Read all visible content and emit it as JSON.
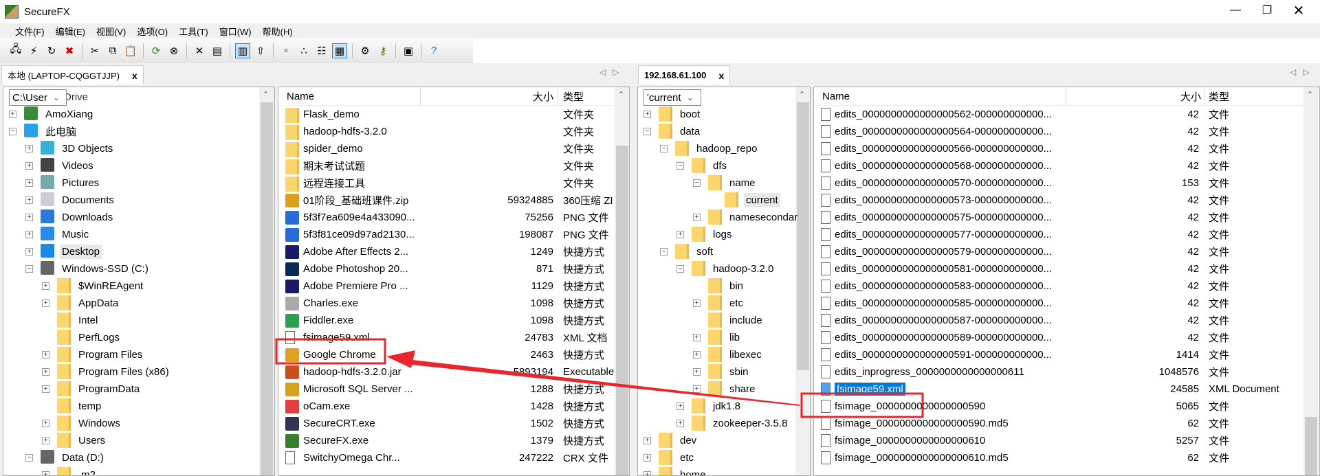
{
  "window": {
    "title": "SecureFX",
    "controls": [
      "minimize",
      "restore",
      "close"
    ]
  },
  "menu": [
    "文件(F)",
    "编辑(E)",
    "视图(V)",
    "选项(O)",
    "工具(T)",
    "窗口(W)",
    "帮助(H)"
  ],
  "toolbar": [
    "connect-icon",
    "quick-connect-icon",
    "reconnect-icon",
    "disconnect-icon",
    "|",
    "cut-icon",
    "copy-icon",
    "paste-icon",
    "|",
    "refresh-icon",
    "stop-icon",
    "|",
    "delete-icon",
    "properties-icon",
    "|",
    "tree-view-icon",
    "up-folder-icon",
    "|",
    "large-icons-icon",
    "small-icons-icon",
    "list-view-icon",
    "details-view-icon",
    "|",
    "session-options-icon",
    "key-icon",
    "|",
    "transfer-queue-icon",
    "|",
    "help-icon"
  ],
  "colors": {
    "accent": "#0078d7",
    "annotation": "#e8262b",
    "folder": "#fbd66e"
  },
  "local": {
    "tab": "本地 (LAPTOP-CQGGTJJP)",
    "path_combo": "C:\\User",
    "tree_partial_top": "Drive",
    "tree": [
      {
        "label": "AmoXiang",
        "level": 0,
        "exp": "+",
        "icon": "user-icon"
      },
      {
        "label": "此电脑",
        "level": 0,
        "exp": "-",
        "icon": "computer-icon"
      },
      {
        "label": "3D Objects",
        "level": 1,
        "exp": "+",
        "icon": "3d-objects-icon"
      },
      {
        "label": "Videos",
        "level": 1,
        "exp": "+",
        "icon": "videos-icon"
      },
      {
        "label": "Pictures",
        "level": 1,
        "exp": "+",
        "icon": "pictures-icon"
      },
      {
        "label": "Documents",
        "level": 1,
        "exp": "+",
        "icon": "documents-icon"
      },
      {
        "label": "Downloads",
        "level": 1,
        "exp": "+",
        "icon": "downloads-icon"
      },
      {
        "label": "Music",
        "level": 1,
        "exp": "+",
        "icon": "music-icon"
      },
      {
        "label": "Desktop",
        "level": 1,
        "exp": "+",
        "icon": "desktop-icon",
        "selected": true
      },
      {
        "label": "Windows-SSD (C:)",
        "level": 1,
        "exp": "-",
        "icon": "drive-icon"
      },
      {
        "label": "$WinREAgent",
        "level": 2,
        "exp": "+",
        "icon": "folder-icon"
      },
      {
        "label": "AppData",
        "level": 2,
        "exp": "+",
        "icon": "folder-icon"
      },
      {
        "label": "Intel",
        "level": 2,
        "exp": "",
        "icon": "folder-icon"
      },
      {
        "label": "PerfLogs",
        "level": 2,
        "exp": "",
        "icon": "folder-icon"
      },
      {
        "label": "Program Files",
        "level": 2,
        "exp": "+",
        "icon": "folder-icon"
      },
      {
        "label": "Program Files (x86)",
        "level": 2,
        "exp": "+",
        "icon": "folder-icon"
      },
      {
        "label": "ProgramData",
        "level": 2,
        "exp": "+",
        "icon": "folder-icon"
      },
      {
        "label": "temp",
        "level": 2,
        "exp": "",
        "icon": "folder-icon"
      },
      {
        "label": "Windows",
        "level": 2,
        "exp": "+",
        "icon": "folder-icon"
      },
      {
        "label": "Users",
        "level": 2,
        "exp": "+",
        "icon": "folder-icon"
      },
      {
        "label": "Data (D:)",
        "level": 1,
        "exp": "-",
        "icon": "drive-icon"
      },
      {
        "label": ".m2",
        "level": 2,
        "exp": "+",
        "icon": "folder-icon"
      }
    ],
    "columns": {
      "name": "Name",
      "size": "大小",
      "type": "类型"
    },
    "files": [
      {
        "name": "Flask_demo",
        "size": "",
        "type": "文件夹",
        "icon": "folder-icon"
      },
      {
        "name": "hadoop-hdfs-3.2.0",
        "size": "",
        "type": "文件夹",
        "icon": "folder-icon"
      },
      {
        "name": "spider_demo",
        "size": "",
        "type": "文件夹",
        "icon": "folder-icon"
      },
      {
        "name": "期末考试试题",
        "size": "",
        "type": "文件夹",
        "icon": "folder-icon"
      },
      {
        "name": "远程连接工具",
        "size": "",
        "type": "文件夹",
        "icon": "folder-icon"
      },
      {
        "name": "01阶段_基础班课件.zip",
        "size": "59324885",
        "type": "360压缩 ZI",
        "icon": "zip-icon"
      },
      {
        "name": "5f3f7ea609e4a433090...",
        "size": "75256",
        "type": "PNG 文件",
        "icon": "image-icon"
      },
      {
        "name": "5f3f81ce09d97ad2130...",
        "size": "198087",
        "type": "PNG 文件",
        "icon": "image-icon"
      },
      {
        "name": "Adobe After Effects 2...",
        "size": "1249",
        "type": "快捷方式",
        "icon": "after-effects-icon"
      },
      {
        "name": "Adobe Photoshop 20...",
        "size": "871",
        "type": "快捷方式",
        "icon": "photoshop-icon"
      },
      {
        "name": "Adobe Premiere Pro ...",
        "size": "1129",
        "type": "快捷方式",
        "icon": "premiere-icon"
      },
      {
        "name": "Charles.exe",
        "size": "1098",
        "type": "快捷方式",
        "icon": "charles-icon"
      },
      {
        "name": "Fiddler.exe",
        "size": "1098",
        "type": "快捷方式",
        "icon": "fiddler-icon"
      },
      {
        "name": "fsimage59.xml",
        "size": "24783",
        "type": "XML 文档",
        "icon": "file-icon"
      },
      {
        "name": "Google Chrome",
        "size": "2463",
        "type": "快捷方式",
        "icon": "chrome-icon"
      },
      {
        "name": "hadoop-hdfs-3.2.0.jar",
        "size": "5893194",
        "type": "Executable",
        "icon": "jar-icon"
      },
      {
        "name": "Microsoft SQL Server ...",
        "size": "1288",
        "type": "快捷方式",
        "icon": "sql-server-icon"
      },
      {
        "name": "oCam.exe",
        "size": "1428",
        "type": "快捷方式",
        "icon": "ocam-icon"
      },
      {
        "name": "SecureCRT.exe",
        "size": "1502",
        "type": "快捷方式",
        "icon": "securecrt-icon"
      },
      {
        "name": "SecureFX.exe",
        "size": "1379",
        "type": "快捷方式",
        "icon": "securefx-icon"
      },
      {
        "name": "SwitchyOmega Chr...",
        "size": "247222",
        "type": "CRX 文件",
        "icon": "file-icon"
      }
    ]
  },
  "remote": {
    "tab": "192.168.61.100",
    "path_combo": "'current",
    "tree": [
      {
        "label": "boot",
        "level": 0,
        "exp": "+"
      },
      {
        "label": "data",
        "level": 0,
        "exp": "-"
      },
      {
        "label": "hadoop_repo",
        "level": 1,
        "exp": "-"
      },
      {
        "label": "dfs",
        "level": 2,
        "exp": "-"
      },
      {
        "label": "name",
        "level": 3,
        "exp": "-"
      },
      {
        "label": "current",
        "level": 4,
        "exp": "",
        "selected": true
      },
      {
        "label": "namesecondar",
        "level": 3,
        "exp": "+"
      },
      {
        "label": "logs",
        "level": 2,
        "exp": "+"
      },
      {
        "label": "soft",
        "level": 1,
        "exp": "-"
      },
      {
        "label": "hadoop-3.2.0",
        "level": 2,
        "exp": "-"
      },
      {
        "label": "bin",
        "level": 3,
        "exp": ""
      },
      {
        "label": "etc",
        "level": 3,
        "exp": "+"
      },
      {
        "label": "include",
        "level": 3,
        "exp": ""
      },
      {
        "label": "lib",
        "level": 3,
        "exp": "+"
      },
      {
        "label": "libexec",
        "level": 3,
        "exp": "+"
      },
      {
        "label": "sbin",
        "level": 3,
        "exp": "+"
      },
      {
        "label": "share",
        "level": 3,
        "exp": "+"
      },
      {
        "label": "jdk1.8",
        "level": 2,
        "exp": "+"
      },
      {
        "label": "zookeeper-3.5.8",
        "level": 2,
        "exp": "+"
      },
      {
        "label": "dev",
        "level": 0,
        "exp": "+"
      },
      {
        "label": "etc",
        "level": 0,
        "exp": "+"
      },
      {
        "label": "home",
        "level": 0,
        "exp": "+"
      }
    ],
    "columns": {
      "name": "Name",
      "size": "大小",
      "type": "类型"
    },
    "files": [
      {
        "name": "edits_0000000000000000562-000000000000...",
        "size": "42",
        "type": "文件"
      },
      {
        "name": "edits_0000000000000000564-000000000000...",
        "size": "42",
        "type": "文件"
      },
      {
        "name": "edits_0000000000000000566-000000000000...",
        "size": "42",
        "type": "文件"
      },
      {
        "name": "edits_0000000000000000568-000000000000...",
        "size": "42",
        "type": "文件"
      },
      {
        "name": "edits_0000000000000000570-000000000000...",
        "size": "153",
        "type": "文件"
      },
      {
        "name": "edits_0000000000000000573-000000000000...",
        "size": "42",
        "type": "文件"
      },
      {
        "name": "edits_0000000000000000575-000000000000...",
        "size": "42",
        "type": "文件"
      },
      {
        "name": "edits_0000000000000000577-000000000000...",
        "size": "42",
        "type": "文件"
      },
      {
        "name": "edits_0000000000000000579-000000000000...",
        "size": "42",
        "type": "文件"
      },
      {
        "name": "edits_0000000000000000581-000000000000...",
        "size": "42",
        "type": "文件"
      },
      {
        "name": "edits_0000000000000000583-000000000000...",
        "size": "42",
        "type": "文件"
      },
      {
        "name": "edits_0000000000000000585-000000000000...",
        "size": "42",
        "type": "文件"
      },
      {
        "name": "edits_0000000000000000587-000000000000...",
        "size": "42",
        "type": "文件"
      },
      {
        "name": "edits_0000000000000000589-000000000000...",
        "size": "42",
        "type": "文件"
      },
      {
        "name": "edits_0000000000000000591-000000000000...",
        "size": "1414",
        "type": "文件"
      },
      {
        "name": "edits_inprogress_0000000000000000611",
        "size": "1048576",
        "type": "文件"
      },
      {
        "name": "fsimage59.xml",
        "size": "24585",
        "type": "XML Document",
        "selected": true
      },
      {
        "name": "fsimage_0000000000000000590",
        "size": "5065",
        "type": "文件"
      },
      {
        "name": "fsimage_0000000000000000590.md5",
        "size": "62",
        "type": "文件"
      },
      {
        "name": "fsimage_0000000000000000610",
        "size": "5257",
        "type": "文件"
      },
      {
        "name": "fsimage_0000000000000000610.md5",
        "size": "62",
        "type": "文件"
      }
    ]
  }
}
